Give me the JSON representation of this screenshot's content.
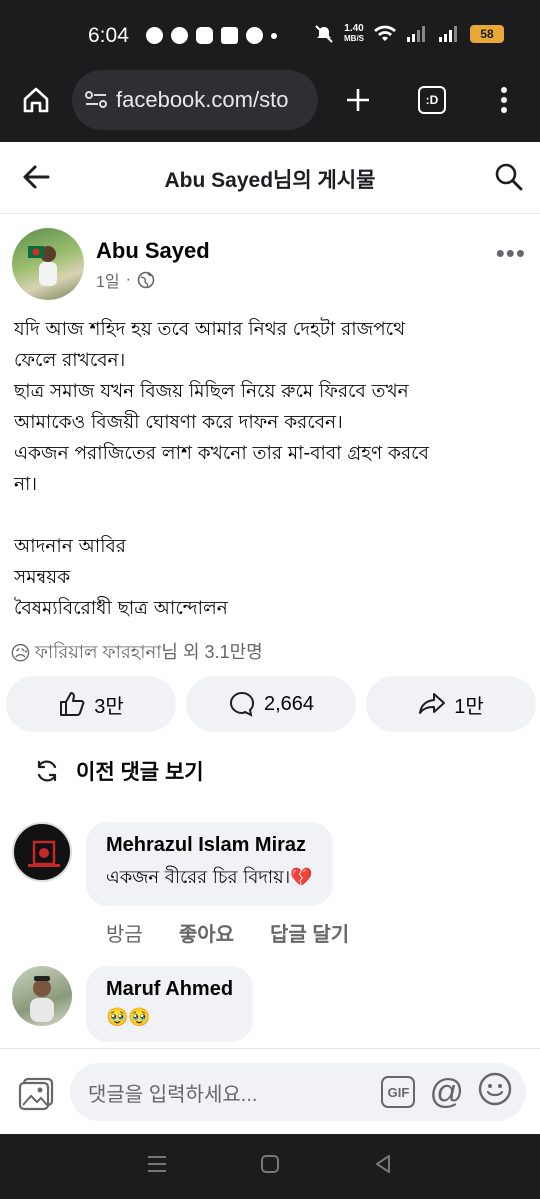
{
  "status_bar": {
    "time": "6:04",
    "net_speed_value": "1.40",
    "net_speed_unit": "MB/S",
    "battery": "58"
  },
  "browser": {
    "url": "facebook.com/sto",
    "tab_label": ":D"
  },
  "header": {
    "title": "Abu Sayed님의 게시물"
  },
  "post": {
    "author": "Abu Sayed",
    "time": "1일",
    "separator": "·",
    "lines": [
      "যদি আজ শহিদ হয় তবে আমার নিথর দেহটা রাজপথে",
      "ফেলে রাখবেন।",
      "ছাত্র সমাজ যখন বিজয় মিছিল নিয়ে রুমে ফিরবে তখন",
      "আমাকেও বিজয়ী ঘোষণা করে দাফন করবেন।",
      "একজন পরাজিতের লাশ কখনো তার মা-বাবা গ্রহণ করবে",
      "না।",
      "",
      "আদনান আবির",
      "সমন্বয়ক",
      "বৈষম্যবিরোধী ছাত্র আন্দোলন"
    ],
    "reactions_emoji": "😥",
    "reactions_text": "ফারিয়াল ফারহানা님 외 3.1만명",
    "likes": "3만",
    "comments": "2,664",
    "shares": "1만"
  },
  "comments_section": {
    "previous_label": "이전 댓글 보기",
    "comments": [
      {
        "name": "Mehrazul Islam Miraz",
        "text": "একজন বীরের চির বিদায়।💔",
        "time": "방금",
        "like_label": "좋아요",
        "reply_label": "답글 달기"
      },
      {
        "name": "Maruf Ahmed",
        "text": "🥹🥹"
      }
    ]
  },
  "composer": {
    "placeholder": "댓글을 입력하세요...",
    "gif_label": "GIF",
    "at_label": "@"
  }
}
